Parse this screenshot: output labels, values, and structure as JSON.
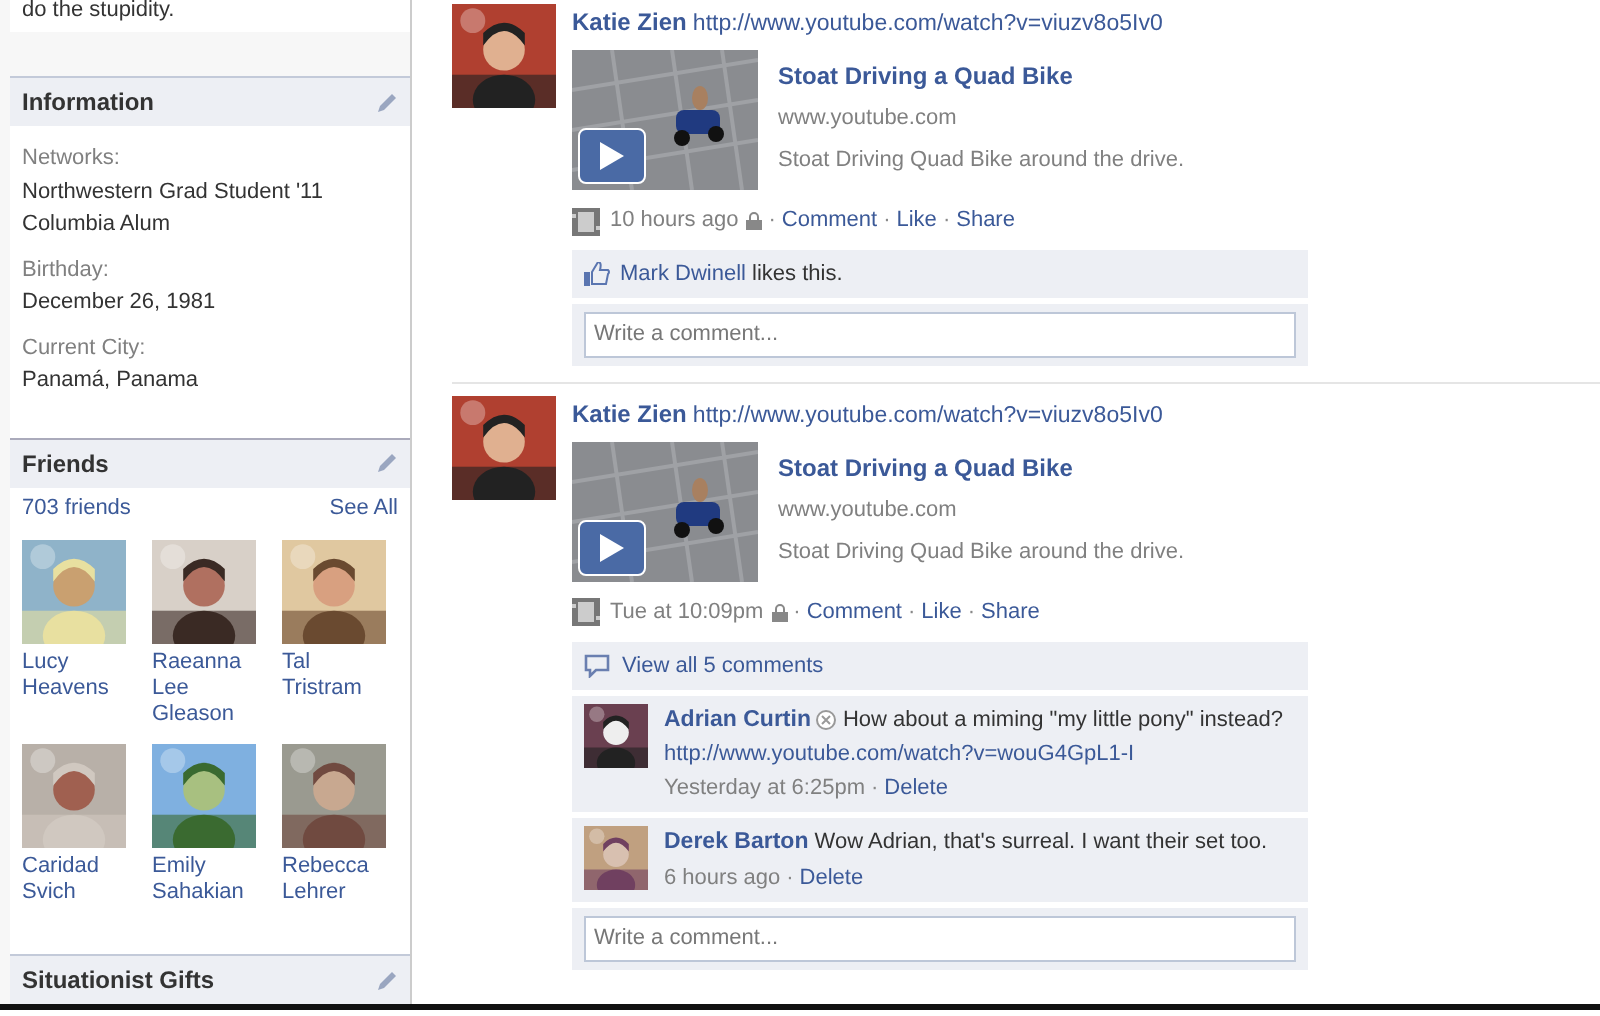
{
  "top_fragment": "do the stupidity.",
  "information": {
    "title": "Information",
    "fields": [
      {
        "label": "Networks:",
        "values": [
          "Northwestern Grad Student '11",
          "Columbia Alum"
        ]
      },
      {
        "label": "Birthday:",
        "values": [
          "December 26, 1981"
        ]
      },
      {
        "label": "Current City:",
        "values": [
          "Panamá, Panama"
        ]
      }
    ]
  },
  "friends": {
    "title": "Friends",
    "count": "703 friends",
    "see_all": "See All",
    "people": [
      {
        "name": "Lucy Heavens"
      },
      {
        "name": "Raeanna Lee Gleason"
      },
      {
        "name": "Tal Tristram"
      },
      {
        "name": "Caridad Svich"
      },
      {
        "name": "Emily Sahakian"
      },
      {
        "name": "Rebecca Lehrer"
      }
    ]
  },
  "next_section": {
    "title": "Situationist Gifts"
  },
  "separator": "·",
  "posts": [
    {
      "author": "Katie Zien",
      "text": "http://www.youtube.com/watch?v=viuzv8o5Iv0",
      "link": {
        "title": "Stoat Driving a Quad Bike",
        "domain": "www.youtube.com",
        "description": "Stoat Driving Quad Bike around the drive."
      },
      "time": "10 hours ago",
      "actions": [
        "Comment",
        "Like",
        "Share"
      ],
      "likes": {
        "name": "Mark Dwinell",
        "text": "likes this."
      },
      "comment_placeholder": "Write a comment..."
    },
    {
      "author": "Katie Zien",
      "text": "http://www.youtube.com/watch?v=viuzv8o5Iv0",
      "link": {
        "title": "Stoat Driving a Quad Bike",
        "domain": "www.youtube.com",
        "description": "Stoat Driving Quad Bike around the drive."
      },
      "time": "Tue at 10:09pm",
      "actions": [
        "Comment",
        "Like",
        "Share"
      ],
      "view_all": "View all 5 comments",
      "comments": [
        {
          "author": "Adrian Curtin",
          "removable": true,
          "text": "How about a miming \"my little pony\" instead?",
          "link": "http://www.youtube.com/watch?v=wouG4GpL1-I",
          "time": "Yesterday at 6:25pm",
          "action": "Delete"
        },
        {
          "author": "Derek Barton",
          "removable": false,
          "text": "Wow Adrian, that's surreal. I want their set too.",
          "time": "6 hours ago",
          "action": "Delete"
        }
      ],
      "comment_placeholder": "Write a comment..."
    }
  ]
}
